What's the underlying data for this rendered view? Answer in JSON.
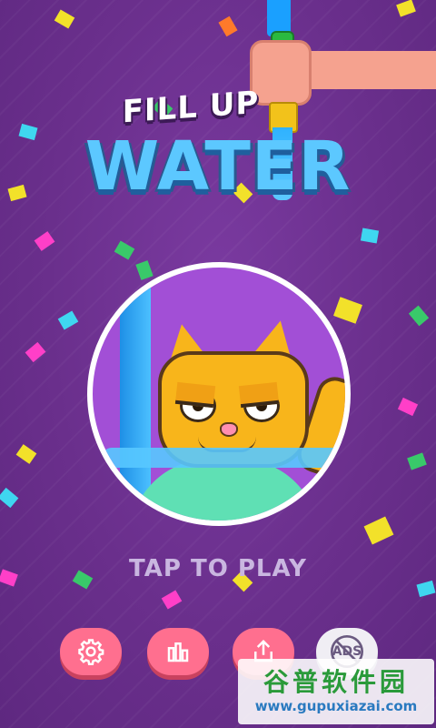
{
  "title": {
    "line1": "FILL UP",
    "line2": "WATER"
  },
  "prompt": "TAP TO PLAY",
  "buttons": [
    {
      "name": "settings",
      "icon": "gear-icon"
    },
    {
      "name": "leaderboard",
      "icon": "bar-chart-icon"
    },
    {
      "name": "share",
      "icon": "share-icon"
    },
    {
      "name": "remove-ads",
      "icon": "no-ads-icon",
      "label": "ADS"
    }
  ],
  "watermark": {
    "text": "谷普软件园",
    "url": "www.gupuxiazai.com"
  },
  "colors": {
    "background": "#6a2f8c",
    "button_pink": "#ff6f8f",
    "title_water": "#5cc8ff"
  }
}
